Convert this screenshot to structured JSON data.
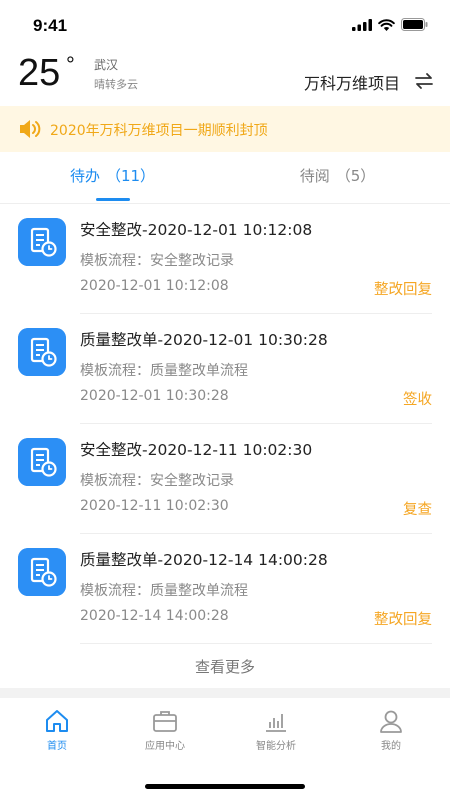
{
  "status_bar": {
    "time": "9:41"
  },
  "header": {
    "temperature": "25",
    "degree_symbol": "°",
    "city": "武汉",
    "weather": "晴转多云",
    "project_name": "万科万维项目",
    "switch_icon": "switch-arrows-icon"
  },
  "notice": {
    "icon": "speaker-icon",
    "text": "2020年万科万维项目一期顺利封顶"
  },
  "tabs": [
    {
      "label": "待办",
      "count": "（11）",
      "active": true
    },
    {
      "label": "待阅",
      "count": "（5）",
      "active": false
    }
  ],
  "list": [
    {
      "title": "安全整改-2020-12-01 10:12:08",
      "subtitle": "模板流程：安全整改记录",
      "date": "2020-12-01 10:12:08",
      "action": "整改回复"
    },
    {
      "title": "质量整改单-2020-12-01 10:30:28",
      "subtitle": "模板流程：质量整改单流程",
      "date": "2020-12-01 10:30:28",
      "action": "签收"
    },
    {
      "title": "安全整改-2020-12-11 10:02:30",
      "subtitle": "模板流程：安全整改记录",
      "date": "2020-12-11 10:02:30",
      "action": "复查"
    },
    {
      "title": "质量整改单-2020-12-14 14:00:28",
      "subtitle": "模板流程：质量整改单流程",
      "date": "2020-12-14 14:00:28",
      "action": "整改回复"
    }
  ],
  "see_more": "查看更多",
  "bottom_nav": [
    {
      "label": "首页",
      "icon": "home-icon",
      "active": true
    },
    {
      "label": "应用中心",
      "icon": "briefcase-icon",
      "active": false
    },
    {
      "label": "智能分析",
      "icon": "bar-chart-icon",
      "active": false
    },
    {
      "label": "我的",
      "icon": "user-icon",
      "active": false
    }
  ],
  "colors": {
    "accent": "#1d8cf0",
    "warning": "#f5a623",
    "notice_bg": "#fff7e3",
    "icon_tile": "#2c8ff5"
  }
}
